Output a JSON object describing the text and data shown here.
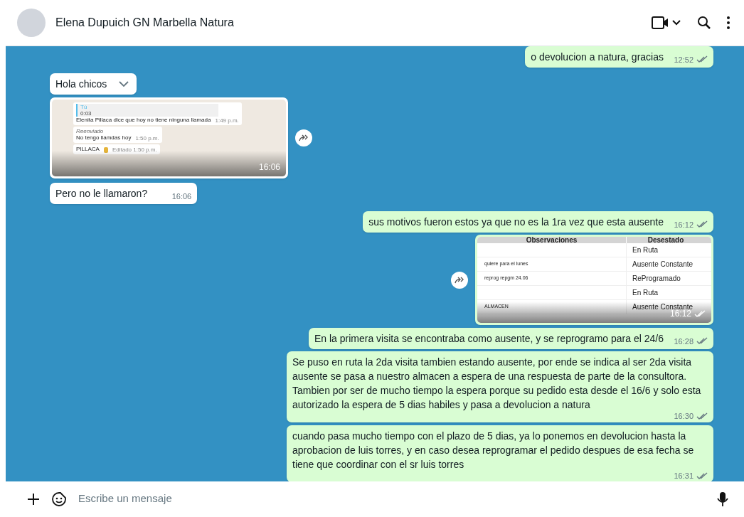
{
  "header": {
    "contact_name": "Elena Dupuich GN Marbella Natura"
  },
  "messages": [
    {
      "kind": "text",
      "outgoing": true,
      "text": "o devolucion a natura, gracias",
      "time": "12:52",
      "read": false
    },
    {
      "kind": "text",
      "outgoing": false,
      "text": "Hola chicos",
      "menu_open": true
    },
    {
      "kind": "chat_image",
      "outgoing": false,
      "time": "16:06",
      "forward": true,
      "bubbles": [
        {
          "quote_author": "Tú",
          "quote_audio": "0:03",
          "text": "Elenita Pillaca dice que hoy  no tiene ninguna llamada",
          "time": "1:49 p.m."
        },
        {
          "forwarded_label": "Reenviado",
          "text": "No tengo llamdas hoy",
          "time": "1:50 p.m."
        },
        {
          "text": "PILLACA",
          "hand": true,
          "time": "Editado 1:50 p.m."
        }
      ]
    },
    {
      "kind": "text",
      "outgoing": false,
      "text": "Pero no le llamaron?",
      "time": "16:06"
    },
    {
      "kind": "text",
      "outgoing": true,
      "text": "sus motivos fueron estos ya que no es la 1ra vez que esta ausente",
      "time": "16:12",
      "read": false
    },
    {
      "kind": "table_image",
      "outgoing": true,
      "time": "16:12",
      "read": false,
      "forward": true,
      "columns": [
        "Observaciones",
        "Desestado"
      ],
      "rows": [
        [
          "",
          "En Ruta"
        ],
        [
          "quiere para el lunes",
          "Ausente Constante"
        ],
        [
          "reprog repgm 24.06",
          "ReProgramado"
        ],
        [
          "",
          "En Ruta"
        ],
        [
          "ALMACEN",
          "Ausente Constante"
        ]
      ]
    },
    {
      "kind": "text",
      "outgoing": true,
      "text": "En la primera visita se encontraba como ausente, y se reprogramo para el 24/6",
      "time": "16:28",
      "read": false
    },
    {
      "kind": "text",
      "outgoing": true,
      "text": "Se puso en ruta la 2da visita tambien estando ausente, por ende se indica al ser 2da visita ausente se pasa a nuestro almacen a espera de una respuesta de parte de la consultora. Tambien por ser  de mucho tiempo la espera porque su pedido esta desde el 16/6 y solo esta autorizado la espera de 5 dias habiles y pasa a devolucion a natura",
      "time": "16:30",
      "read": false
    },
    {
      "kind": "text",
      "outgoing": true,
      "text": "cuando pasa mucho tiempo con el plazo de 5 dias, ya lo ponemos en devolucion hasta la aprobacion de luis torres, y en caso desea reprogramar el pedido despues de esa fecha se tiene que coordinar con el sr luis torres",
      "time": "16:31",
      "read": false
    }
  ],
  "composer": {
    "placeholder": "Escribe un mensaje"
  }
}
